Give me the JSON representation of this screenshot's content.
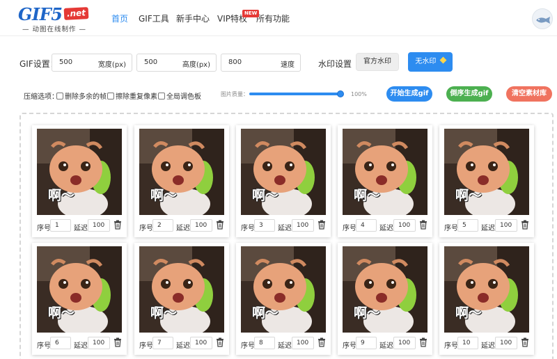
{
  "brand": {
    "logo_main": "GIF5",
    "logo_tld": ".net",
    "tagline": "— 动图在线制作 —"
  },
  "nav": {
    "items": [
      {
        "label": "首页",
        "active": true
      },
      {
        "label": "GIF工具",
        "active": false
      },
      {
        "label": "新手中心",
        "active": false
      },
      {
        "label": "VIP特权",
        "active": false
      },
      {
        "label": "所有功能",
        "active": false
      }
    ],
    "new_badge": "NEW"
  },
  "settings": {
    "gif_label": "GIF设置：",
    "width": {
      "value": "500",
      "unit": "宽度(px)"
    },
    "height": {
      "value": "500",
      "unit": "高度(px)"
    },
    "speed": {
      "value": "800",
      "unit": "速度"
    },
    "watermark_label": "水印设置",
    "watermark_official": "官方水印",
    "watermark_none": "无水印"
  },
  "compression": {
    "label": "压缩选项：",
    "options": [
      {
        "label": "删除多余的帧",
        "checked": false
      },
      {
        "label": "擦除重复像素",
        "checked": false
      },
      {
        "label": "全局调色板",
        "checked": false
      }
    ],
    "quality_label": "图片质量：",
    "quality_value": "100%",
    "quality_fraction": 1.0
  },
  "actions": {
    "start": "开始生成gif",
    "reverse": "倒序生成gif",
    "clear": "清空素材库"
  },
  "colors": {
    "accent": "#2d8cf0",
    "green": "#4cb050",
    "red": "#f0735f",
    "new_badge": "#e53935"
  },
  "frames": {
    "index_label": "序号",
    "delay_label": "延迟",
    "caption": "啊～",
    "items": [
      {
        "index": "1",
        "delay": "100"
      },
      {
        "index": "2",
        "delay": "100"
      },
      {
        "index": "3",
        "delay": "100"
      },
      {
        "index": "4",
        "delay": "100"
      },
      {
        "index": "5",
        "delay": "100"
      },
      {
        "index": "6",
        "delay": "100"
      },
      {
        "index": "7",
        "delay": "100"
      },
      {
        "index": "8",
        "delay": "100"
      },
      {
        "index": "9",
        "delay": "100"
      },
      {
        "index": "10",
        "delay": "100"
      }
    ]
  }
}
